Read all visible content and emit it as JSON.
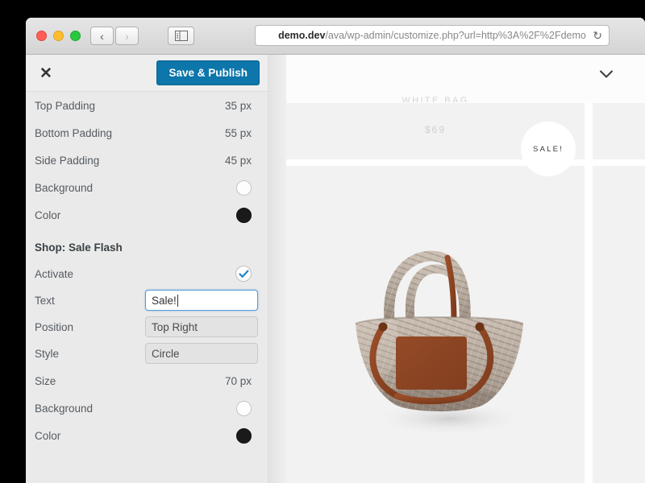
{
  "browser": {
    "traffic_lights": [
      "close",
      "minimize",
      "maximize"
    ],
    "back_label": "‹",
    "forward_label": "›",
    "sidebar_toggle_icon": "sidebar-panel-icon",
    "url_bold": "demo.dev",
    "url_rest": "/ava/wp-admin/customize.php?url=http%3A%2F%2Fdemo",
    "reload_icon": "↻"
  },
  "customizer": {
    "close_label": "✕",
    "save_label": "Save & Publish",
    "controls": [
      {
        "label": "Top Padding",
        "value": "35 px",
        "kind": "value"
      },
      {
        "label": "Bottom Padding",
        "value": "55 px",
        "kind": "value"
      },
      {
        "label": "Side Padding",
        "value": "45 px",
        "kind": "value"
      },
      {
        "label": "Background",
        "value": "",
        "kind": "swatch-white"
      },
      {
        "label": "Color",
        "value": "",
        "kind": "swatch-black"
      }
    ],
    "section": {
      "title": "Shop: Sale Flash",
      "activate": {
        "label": "Activate",
        "checked": true
      },
      "text": {
        "label": "Text",
        "value": "Sale!"
      },
      "position": {
        "label": "Position",
        "value": "Top Right"
      },
      "style": {
        "label": "Style",
        "value": "Circle"
      },
      "size": {
        "label": "Size",
        "value": "70 px"
      },
      "background": {
        "label": "Background",
        "value": ""
      },
      "color": {
        "label": "Color",
        "value": ""
      }
    }
  },
  "preview": {
    "chevron_icon": "chevron-down-icon",
    "ghost_product_name": "WHITE BAG",
    "price": "$69",
    "sale_badge_text": "SALE!",
    "product_alt": "woven-straw-basket-bag"
  },
  "colors": {
    "accent_blue": "#0d76ab",
    "focus_blue": "#5b9dd9",
    "sidebar_bg": "#eaeaea",
    "swatch_black": "#1a1a1a",
    "swatch_white": "#fdfdfd",
    "page_bg": "#000000"
  }
}
